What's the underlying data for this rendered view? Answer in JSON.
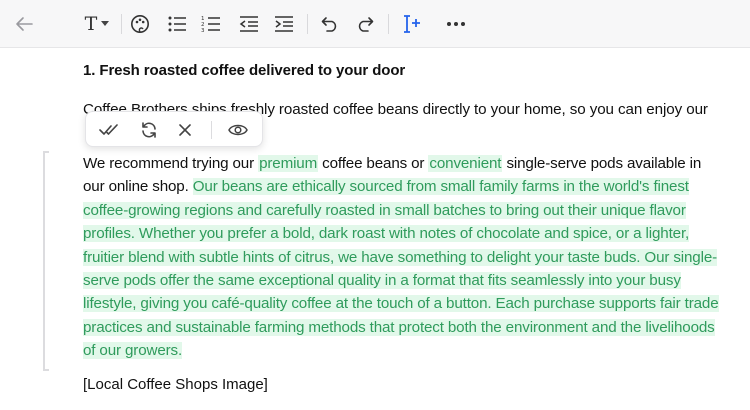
{
  "toolbar": {
    "icons": [
      "back-arrow-icon",
      "text-style-icon",
      "chevron-down-icon",
      "palette-icon",
      "bullet-list-icon",
      "numbered-list-icon",
      "outdent-icon",
      "indent-icon",
      "undo-icon",
      "redo-icon",
      "ai-text-cursor-icon",
      "more-icon"
    ],
    "text_style_label": "T"
  },
  "document": {
    "heading": "1. Fresh roasted coffee delivered to your door",
    "para1": "Coffee Brothers ships freshly roasted coffee beans directly to your home, so you can enjoy our",
    "para2_prefix": "We recommend trying our ",
    "para2_word1": "premium",
    "para2_mid": " coffee beans or ",
    "para2_word2": "convenient",
    "para2_after": " single-serve pods available in our online shop. ",
    "para2_suggestion": "Our beans are ethically sourced from small family farms in the world's finest coffee-growing regions and carefully roasted in small batches to bring out their unique flavor profiles. Whether you prefer a bold, dark roast with notes of chocolate and spice, or a lighter, fruitier blend with subtle hints of citrus, we have something to delight your taste buds. Our single-serve pods offer the same exceptional quality in a format that fits seamlessly into your busy lifestyle, giving you café-quality coffee at the touch of a button. Each purchase supports fair trade practices and sustainable farming methods that protect both the environment and the livelihoods of our growers.",
    "image_placeholder": "[Local Coffee Shops Image]"
  },
  "suggestion_toolbar": {
    "icons": [
      "accept-all-icon",
      "regenerate-icon",
      "reject-icon",
      "preview-icon"
    ]
  },
  "colors": {
    "highlight_bg": "#e2f8ea",
    "highlight_text": "#2f9b5c",
    "accent_blue": "#2563eb"
  }
}
